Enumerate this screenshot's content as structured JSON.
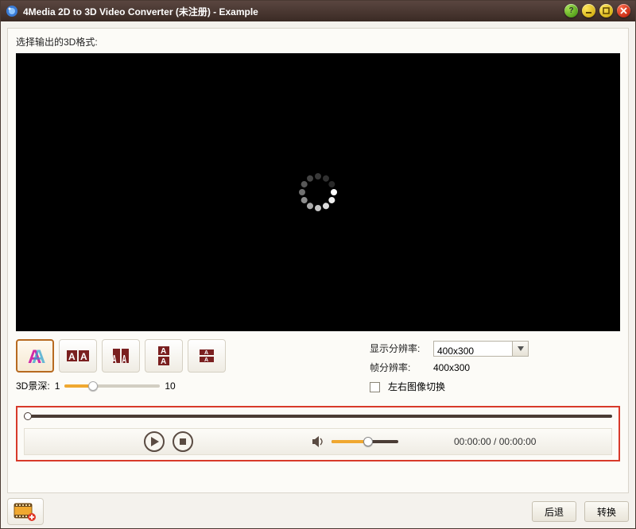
{
  "window": {
    "title": "4Media 2D to 3D Video Converter (未注册) - Example"
  },
  "prompt": "选择输出的3D格式:",
  "modes": {
    "depth_label": "3D景深:",
    "depth_min": "1",
    "depth_max": "10",
    "items": [
      {
        "name": "anaglyph"
      },
      {
        "name": "side-by-side"
      },
      {
        "name": "side-by-side-half"
      },
      {
        "name": "top-bottom"
      },
      {
        "name": "top-bottom-half"
      }
    ]
  },
  "resolution": {
    "display_label": "显示分辨率:",
    "display_value": "400x300",
    "frame_label": "帧分辨率:",
    "frame_value": "400x300",
    "swap_label": "左右图像切换"
  },
  "player": {
    "time_current": "00:00:00",
    "time_sep": " / ",
    "time_total": "00:00:00"
  },
  "footer": {
    "back": "后退",
    "convert": "转换"
  }
}
